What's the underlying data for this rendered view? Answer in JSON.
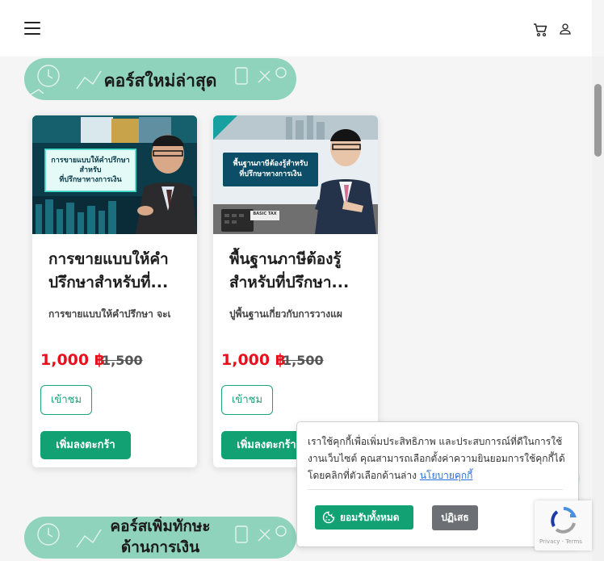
{
  "header": {
    "menu_icon": "hamburger-menu-icon",
    "cart_icon": "shopping-cart-icon",
    "user_icon": "user-icon"
  },
  "sections": [
    {
      "title": "คอร์สใหม่ล่าสุด"
    },
    {
      "title_line1": "คอร์สเพิ่มทักษะ",
      "title_line2": "ด้านการเงิน"
    }
  ],
  "courses": [
    {
      "image_text_line1": "การขายแบบให้คำปรึกษา",
      "image_text_line2": "สำหรับ",
      "image_text_line3": "ที่ปรึกษาทางการเงิน",
      "title": "การขายแบบให้คำปรึกษาสำหรับที่...",
      "description": "การขายแบบให้คำปรึกษา จะเ",
      "price": "1,000 ฿",
      "original_price": "1,500",
      "view_label": "เข้าชม",
      "add_cart_label": "เพิ่มลงตะกร้า"
    },
    {
      "image_text_line1": "พื้นฐานภาษีต้องรู้สำหรับ",
      "image_text_line2": "ที่ปรึกษาทางการเงิน",
      "image_badge": "BASIC TAX",
      "title": "พื้นฐานภาษีต้องรู้สำหรับที่ปรึกษา...",
      "description": "ปูพื้นฐานเกี่ยวกับการวางแผ",
      "price": "1,000 ฿",
      "original_price": "1,500",
      "view_label": "เข้าชม",
      "add_cart_label": "เพิ่มลงตะกร้า"
    }
  ],
  "cookie_banner": {
    "text": "เราใช้คุกกี้เพื่อเพิ่มประสิทธิภาพ และประสบการณ์ที่ดีในการใช้งานเว็บไซต์ คุณสามารถเลือกตั้งค่าความยินยอมการใช้คุกกี้ได้ โดยคลิกที่ตัวเลือกด้านล่าง",
    "link_text": "นโยบายคุกกี้",
    "accept_label": "ยอมรับทั้งหมด",
    "reject_label": "ปฏิเสธ"
  },
  "recaptcha": {
    "text": "Privacy - Terms"
  },
  "colors": {
    "brand_green": "#11a173",
    "banner_mint": "#8fd3bc",
    "price_red": "#e8101c"
  }
}
